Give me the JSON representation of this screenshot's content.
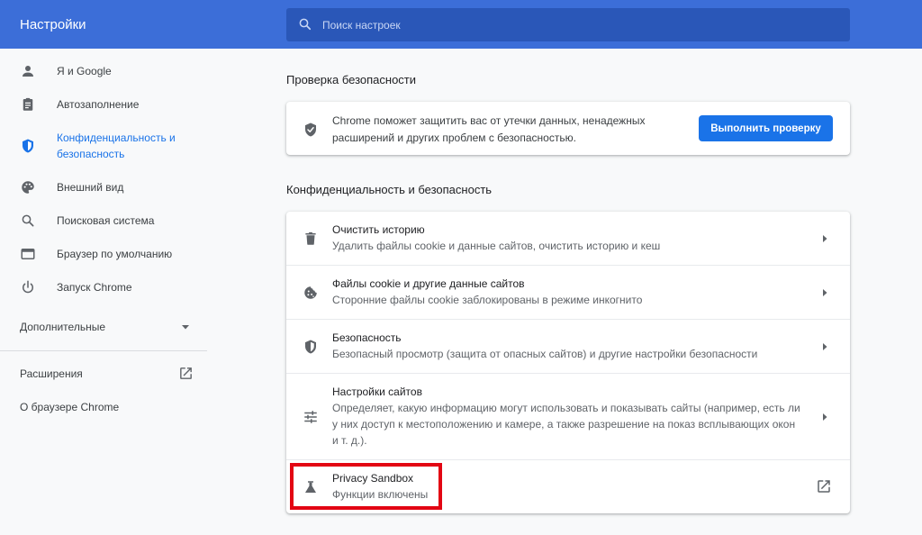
{
  "header": {
    "title": "Настройки",
    "search_placeholder": "Поиск настроек"
  },
  "sidebar": {
    "items": [
      {
        "label": "Я и Google",
        "icon": "person-icon"
      },
      {
        "label": "Автозаполнение",
        "icon": "clipboard-icon"
      },
      {
        "label": "Конфиденциальность и безопасность",
        "icon": "shield-icon"
      },
      {
        "label": "Внешний вид",
        "icon": "palette-icon"
      },
      {
        "label": "Поисковая система",
        "icon": "search-icon"
      },
      {
        "label": "Браузер по умолчанию",
        "icon": "browser-icon"
      },
      {
        "label": "Запуск Chrome",
        "icon": "power-icon"
      }
    ],
    "advanced_label": "Дополнительные",
    "extensions_label": "Расширения",
    "about_label": "О браузере Chrome"
  },
  "safety_check": {
    "title": "Проверка безопасности",
    "text": "Chrome поможет защитить вас от утечки данных, ненадежных расширений и других проблем с безопасностью.",
    "button_label": "Выполнить проверку"
  },
  "privacy": {
    "title": "Конфиденциальность и безопасность",
    "rows": [
      {
        "title": "Очистить историю",
        "subtitle": "Удалить файлы cookie и данные сайтов, очистить историю и кеш",
        "icon": "trash-icon"
      },
      {
        "title": "Файлы cookie и другие данные сайтов",
        "subtitle": "Сторонние файлы cookie заблокированы в режиме инкогнито",
        "icon": "cookie-icon"
      },
      {
        "title": "Безопасность",
        "subtitle": "Безопасный просмотр (защита от опасных сайтов) и другие настройки безопасности",
        "icon": "security-shield-icon"
      },
      {
        "title": "Настройки сайтов",
        "subtitle": "Определяет, какую информацию могут использовать и показывать сайты (например, есть ли у них доступ к местоположению и камере, а также разрешение на показ всплывающих окон и т. д.).",
        "icon": "tune-icon"
      },
      {
        "title": "Privacy Sandbox",
        "subtitle": "Функции включены",
        "icon": "flask-icon"
      }
    ]
  },
  "colors": {
    "header": "#3c6ed8",
    "accent": "#1a73e8",
    "highlight": "#e30613"
  }
}
